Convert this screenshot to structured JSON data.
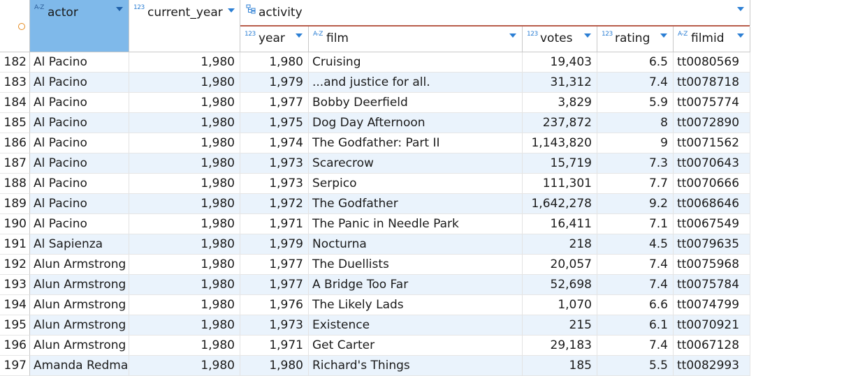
{
  "headers": {
    "actor": {
      "type": "A-Z",
      "label": "actor"
    },
    "current_year": {
      "type": "123",
      "label": "current_year"
    },
    "activity": {
      "label": "activity"
    },
    "year": {
      "type": "123",
      "label": "year"
    },
    "film": {
      "type": "A-Z",
      "label": "film"
    },
    "votes": {
      "type": "123",
      "label": "votes"
    },
    "rating": {
      "type": "123",
      "label": "rating"
    },
    "filmid": {
      "type": "A-Z",
      "label": "filmid"
    }
  },
  "rows": [
    {
      "n": "182",
      "actor": "Al Pacino",
      "current_year": "1,980",
      "year": "1,980",
      "film": "Cruising",
      "votes": "19,403",
      "rating": "6.5",
      "filmid": "tt0080569"
    },
    {
      "n": "183",
      "actor": "Al Pacino",
      "current_year": "1,980",
      "year": "1,979",
      "film": "...and justice for all.",
      "votes": "31,312",
      "rating": "7.4",
      "filmid": "tt0078718"
    },
    {
      "n": "184",
      "actor": "Al Pacino",
      "current_year": "1,980",
      "year": "1,977",
      "film": "Bobby Deerfield",
      "votes": "3,829",
      "rating": "5.9",
      "filmid": "tt0075774"
    },
    {
      "n": "185",
      "actor": "Al Pacino",
      "current_year": "1,980",
      "year": "1,975",
      "film": "Dog Day Afternoon",
      "votes": "237,872",
      "rating": "8",
      "filmid": "tt0072890"
    },
    {
      "n": "186",
      "actor": "Al Pacino",
      "current_year": "1,980",
      "year": "1,974",
      "film": "The Godfather: Part II",
      "votes": "1,143,820",
      "rating": "9",
      "filmid": "tt0071562"
    },
    {
      "n": "187",
      "actor": "Al Pacino",
      "current_year": "1,980",
      "year": "1,973",
      "film": "Scarecrow",
      "votes": "15,719",
      "rating": "7.3",
      "filmid": "tt0070643"
    },
    {
      "n": "188",
      "actor": "Al Pacino",
      "current_year": "1,980",
      "year": "1,973",
      "film": "Serpico",
      "votes": "111,301",
      "rating": "7.7",
      "filmid": "tt0070666"
    },
    {
      "n": "189",
      "actor": "Al Pacino",
      "current_year": "1,980",
      "year": "1,972",
      "film": "The Godfather",
      "votes": "1,642,278",
      "rating": "9.2",
      "filmid": "tt0068646"
    },
    {
      "n": "190",
      "actor": "Al Pacino",
      "current_year": "1,980",
      "year": "1,971",
      "film": "The Panic in Needle Park",
      "votes": "16,411",
      "rating": "7.1",
      "filmid": "tt0067549"
    },
    {
      "n": "191",
      "actor": "Al Sapienza",
      "current_year": "1,980",
      "year": "1,979",
      "film": "Nocturna",
      "votes": "218",
      "rating": "4.5",
      "filmid": "tt0079635"
    },
    {
      "n": "192",
      "actor": "Alun Armstrong",
      "current_year": "1,980",
      "year": "1,977",
      "film": "The Duellists",
      "votes": "20,057",
      "rating": "7.4",
      "filmid": "tt0075968"
    },
    {
      "n": "193",
      "actor": "Alun Armstrong",
      "current_year": "1,980",
      "year": "1,977",
      "film": "A Bridge Too Far",
      "votes": "52,698",
      "rating": "7.4",
      "filmid": "tt0075784"
    },
    {
      "n": "194",
      "actor": "Alun Armstrong",
      "current_year": "1,980",
      "year": "1,976",
      "film": "The Likely Lads",
      "votes": "1,070",
      "rating": "6.6",
      "filmid": "tt0074799"
    },
    {
      "n": "195",
      "actor": "Alun Armstrong",
      "current_year": "1,980",
      "year": "1,973",
      "film": "Existence",
      "votes": "215",
      "rating": "6.1",
      "filmid": "tt0070921"
    },
    {
      "n": "196",
      "actor": "Alun Armstrong",
      "current_year": "1,980",
      "year": "1,971",
      "film": "Get Carter",
      "votes": "29,183",
      "rating": "7.4",
      "filmid": "tt0067128"
    },
    {
      "n": "197",
      "actor": "Amanda Redman",
      "current_year": "1,980",
      "year": "1,980",
      "film": "Richard's Things",
      "votes": "185",
      "rating": "5.5",
      "filmid": "tt0082993"
    }
  ],
  "colors": {
    "selected_header": "#7fb9ea",
    "alt_row": "#eaf3fc",
    "type_icon": "#2c7fd4",
    "group_underline": "#b85c4a",
    "corner_indicator": "#e58a1f"
  },
  "icons": {
    "corner": "circle-indicator-icon",
    "activity": "tree-structure-icon",
    "sort": "dropdown-arrow-icon"
  }
}
